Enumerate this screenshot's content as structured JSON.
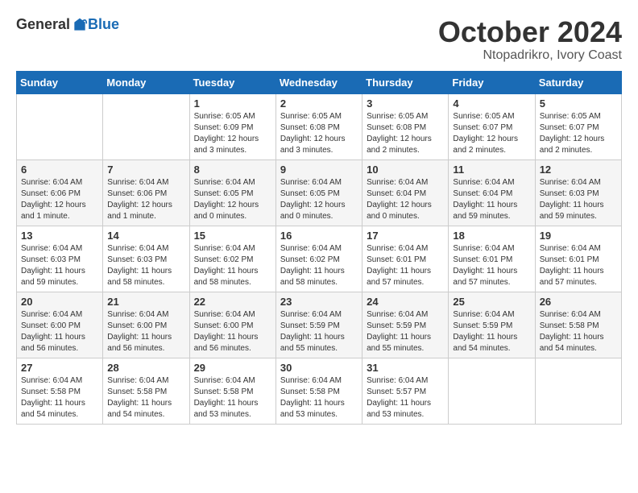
{
  "header": {
    "logo_general": "General",
    "logo_blue": "Blue",
    "month_title": "October 2024",
    "location": "Ntopadrikro, Ivory Coast"
  },
  "weekdays": [
    "Sunday",
    "Monday",
    "Tuesday",
    "Wednesday",
    "Thursday",
    "Friday",
    "Saturday"
  ],
  "weeks": [
    [
      {
        "day": "",
        "info": ""
      },
      {
        "day": "",
        "info": ""
      },
      {
        "day": "1",
        "info": "Sunrise: 6:05 AM\nSunset: 6:09 PM\nDaylight: 12 hours and 3 minutes."
      },
      {
        "day": "2",
        "info": "Sunrise: 6:05 AM\nSunset: 6:08 PM\nDaylight: 12 hours and 3 minutes."
      },
      {
        "day": "3",
        "info": "Sunrise: 6:05 AM\nSunset: 6:08 PM\nDaylight: 12 hours and 2 minutes."
      },
      {
        "day": "4",
        "info": "Sunrise: 6:05 AM\nSunset: 6:07 PM\nDaylight: 12 hours and 2 minutes."
      },
      {
        "day": "5",
        "info": "Sunrise: 6:05 AM\nSunset: 6:07 PM\nDaylight: 12 hours and 2 minutes."
      }
    ],
    [
      {
        "day": "6",
        "info": "Sunrise: 6:04 AM\nSunset: 6:06 PM\nDaylight: 12 hours and 1 minute."
      },
      {
        "day": "7",
        "info": "Sunrise: 6:04 AM\nSunset: 6:06 PM\nDaylight: 12 hours and 1 minute."
      },
      {
        "day": "8",
        "info": "Sunrise: 6:04 AM\nSunset: 6:05 PM\nDaylight: 12 hours and 0 minutes."
      },
      {
        "day": "9",
        "info": "Sunrise: 6:04 AM\nSunset: 6:05 PM\nDaylight: 12 hours and 0 minutes."
      },
      {
        "day": "10",
        "info": "Sunrise: 6:04 AM\nSunset: 6:04 PM\nDaylight: 12 hours and 0 minutes."
      },
      {
        "day": "11",
        "info": "Sunrise: 6:04 AM\nSunset: 6:04 PM\nDaylight: 11 hours and 59 minutes."
      },
      {
        "day": "12",
        "info": "Sunrise: 6:04 AM\nSunset: 6:03 PM\nDaylight: 11 hours and 59 minutes."
      }
    ],
    [
      {
        "day": "13",
        "info": "Sunrise: 6:04 AM\nSunset: 6:03 PM\nDaylight: 11 hours and 59 minutes."
      },
      {
        "day": "14",
        "info": "Sunrise: 6:04 AM\nSunset: 6:03 PM\nDaylight: 11 hours and 58 minutes."
      },
      {
        "day": "15",
        "info": "Sunrise: 6:04 AM\nSunset: 6:02 PM\nDaylight: 11 hours and 58 minutes."
      },
      {
        "day": "16",
        "info": "Sunrise: 6:04 AM\nSunset: 6:02 PM\nDaylight: 11 hours and 58 minutes."
      },
      {
        "day": "17",
        "info": "Sunrise: 6:04 AM\nSunset: 6:01 PM\nDaylight: 11 hours and 57 minutes."
      },
      {
        "day": "18",
        "info": "Sunrise: 6:04 AM\nSunset: 6:01 PM\nDaylight: 11 hours and 57 minutes."
      },
      {
        "day": "19",
        "info": "Sunrise: 6:04 AM\nSunset: 6:01 PM\nDaylight: 11 hours and 57 minutes."
      }
    ],
    [
      {
        "day": "20",
        "info": "Sunrise: 6:04 AM\nSunset: 6:00 PM\nDaylight: 11 hours and 56 minutes."
      },
      {
        "day": "21",
        "info": "Sunrise: 6:04 AM\nSunset: 6:00 PM\nDaylight: 11 hours and 56 minutes."
      },
      {
        "day": "22",
        "info": "Sunrise: 6:04 AM\nSunset: 6:00 PM\nDaylight: 11 hours and 56 minutes."
      },
      {
        "day": "23",
        "info": "Sunrise: 6:04 AM\nSunset: 5:59 PM\nDaylight: 11 hours and 55 minutes."
      },
      {
        "day": "24",
        "info": "Sunrise: 6:04 AM\nSunset: 5:59 PM\nDaylight: 11 hours and 55 minutes."
      },
      {
        "day": "25",
        "info": "Sunrise: 6:04 AM\nSunset: 5:59 PM\nDaylight: 11 hours and 54 minutes."
      },
      {
        "day": "26",
        "info": "Sunrise: 6:04 AM\nSunset: 5:58 PM\nDaylight: 11 hours and 54 minutes."
      }
    ],
    [
      {
        "day": "27",
        "info": "Sunrise: 6:04 AM\nSunset: 5:58 PM\nDaylight: 11 hours and 54 minutes."
      },
      {
        "day": "28",
        "info": "Sunrise: 6:04 AM\nSunset: 5:58 PM\nDaylight: 11 hours and 54 minutes."
      },
      {
        "day": "29",
        "info": "Sunrise: 6:04 AM\nSunset: 5:58 PM\nDaylight: 11 hours and 53 minutes."
      },
      {
        "day": "30",
        "info": "Sunrise: 6:04 AM\nSunset: 5:58 PM\nDaylight: 11 hours and 53 minutes."
      },
      {
        "day": "31",
        "info": "Sunrise: 6:04 AM\nSunset: 5:57 PM\nDaylight: 11 hours and 53 minutes."
      },
      {
        "day": "",
        "info": ""
      },
      {
        "day": "",
        "info": ""
      }
    ]
  ]
}
